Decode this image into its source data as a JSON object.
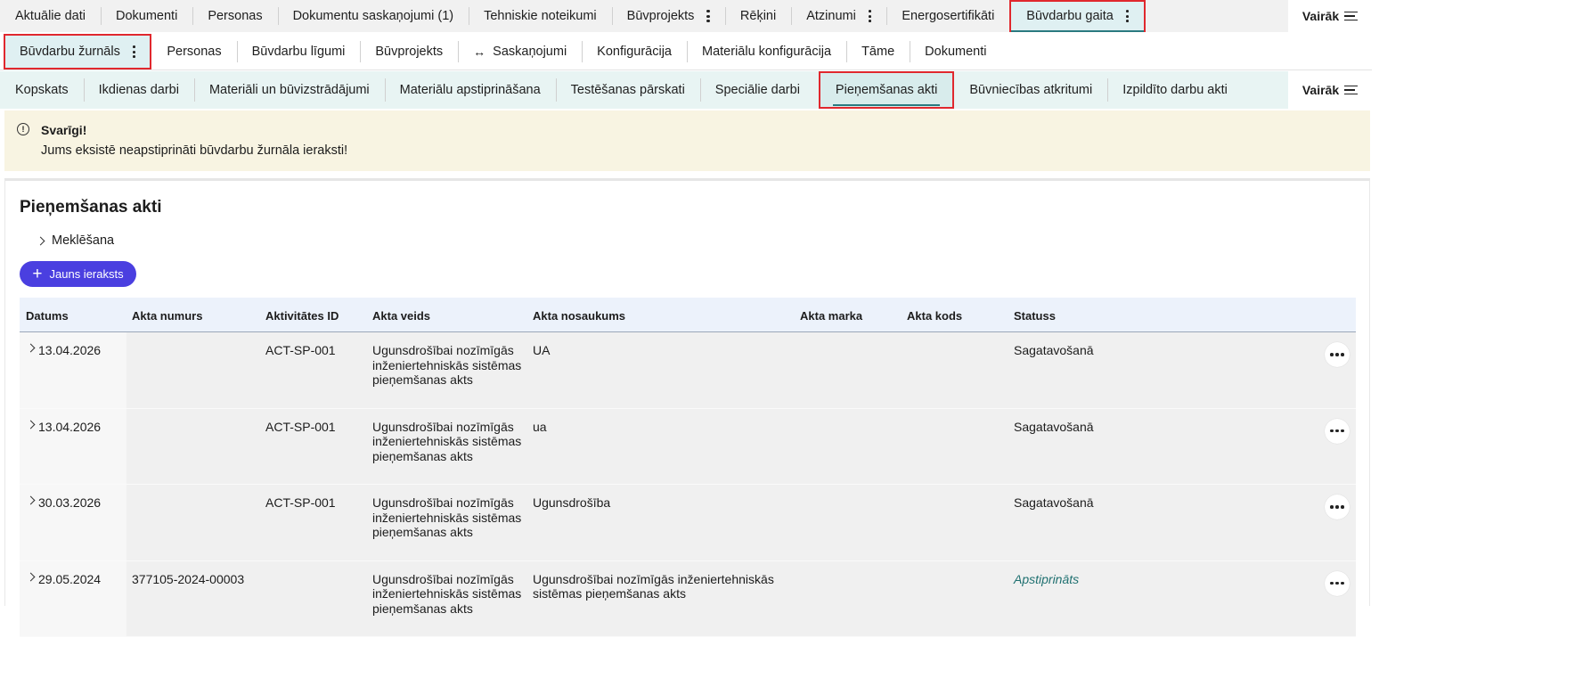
{
  "top_tabs": [
    {
      "label": "Aktuālie dati",
      "kebab": false
    },
    {
      "label": "Dokumenti",
      "kebab": false
    },
    {
      "label": "Personas",
      "kebab": false
    },
    {
      "label": "Dokumentu saskaņojumi (1)",
      "kebab": false
    },
    {
      "label": "Tehniskie noteikumi",
      "kebab": false
    },
    {
      "label": "Būvprojekts",
      "kebab": true
    },
    {
      "label": "Rēķini",
      "kebab": false
    },
    {
      "label": "Atzinumi",
      "kebab": true
    },
    {
      "label": "Energosertifikāti",
      "kebab": false
    },
    {
      "label": "Būvdarbu gaita",
      "kebab": true,
      "active": true
    }
  ],
  "more_label": "Vairāk",
  "second_tabs": [
    {
      "label": "Būvdarbu žurnāls",
      "kebab": true,
      "active": true
    },
    {
      "label": "Personas"
    },
    {
      "label": "Būvdarbu līgumi"
    },
    {
      "label": "Būvprojekts"
    },
    {
      "label": "Saskaņojumi",
      "icon": "swap-icon"
    },
    {
      "label": "Konfigurācija"
    },
    {
      "label": "Materiālu konfigurācija"
    },
    {
      "label": "Tāme"
    },
    {
      "label": "Dokumenti"
    }
  ],
  "third_tabs": [
    {
      "label": "Kopskats"
    },
    {
      "label": "Ikdienas darbi"
    },
    {
      "label": "Materiāli un būvizstrādājumi"
    },
    {
      "label": "Materiālu apstiprināšana"
    },
    {
      "label": "Testēšanas pārskati"
    },
    {
      "label": "Speciālie darbi"
    },
    {
      "label": "Pieņemšanas akti",
      "active": true
    },
    {
      "label": "Būvniecības atkritumi"
    },
    {
      "label": "Izpildīto darbu akti"
    }
  ],
  "alert": {
    "title": "Svarīgi!",
    "message": "Jums eksistē neapstiprināti būvdarbu žurnāla ieraksti!",
    "icon_text": "!"
  },
  "page": {
    "title": "Pieņemšanas akti",
    "search_label": "Meklēšana",
    "new_button_label": "Jauns ieraksts",
    "new_button_icon": "+"
  },
  "table": {
    "headers": [
      "Datums",
      "Akta numurs",
      "Aktivitātes ID",
      "Akta veids",
      "Akta nosaukums",
      "Akta marka",
      "Akta kods",
      "Statuss"
    ],
    "rows": [
      {
        "date": "13.04.2026",
        "number": "",
        "activity_id": "ACT-SP-001",
        "type": "Ugunsdrošībai nozīmīgās inženiertehniskās sistēmas pieņemšanas akts",
        "name": "UA",
        "mark": "",
        "code": "",
        "status": "Sagatavošanā",
        "approved": false
      },
      {
        "date": "13.04.2026",
        "number": "",
        "activity_id": "ACT-SP-001",
        "type": "Ugunsdrošībai nozīmīgās inženiertehniskās sistēmas pieņemšanas akts",
        "name": "ua",
        "mark": "",
        "code": "",
        "status": "Sagatavošanā",
        "approved": false
      },
      {
        "date": "30.03.2026",
        "number": "",
        "activity_id": "ACT-SP-001",
        "type": "Ugunsdrošībai nozīmīgās inženiertehniskās sistēmas pieņemšanas akts",
        "name": "Ugunsdrošība",
        "mark": "",
        "code": "",
        "status": "Sagatavošanā",
        "approved": false
      },
      {
        "date": "29.05.2024",
        "number": "377105-2024-00003",
        "activity_id": "",
        "type": "Ugunsdrošībai nozīmīgās inženiertehniskās sistēmas pieņemšanas akts",
        "name": "Ugunsdrošībai nozīmīgās inženiertehniskās sistēmas pieņemšanas akts",
        "mark": "",
        "code": "",
        "status": "Apstiprināts",
        "approved": true
      }
    ]
  }
}
